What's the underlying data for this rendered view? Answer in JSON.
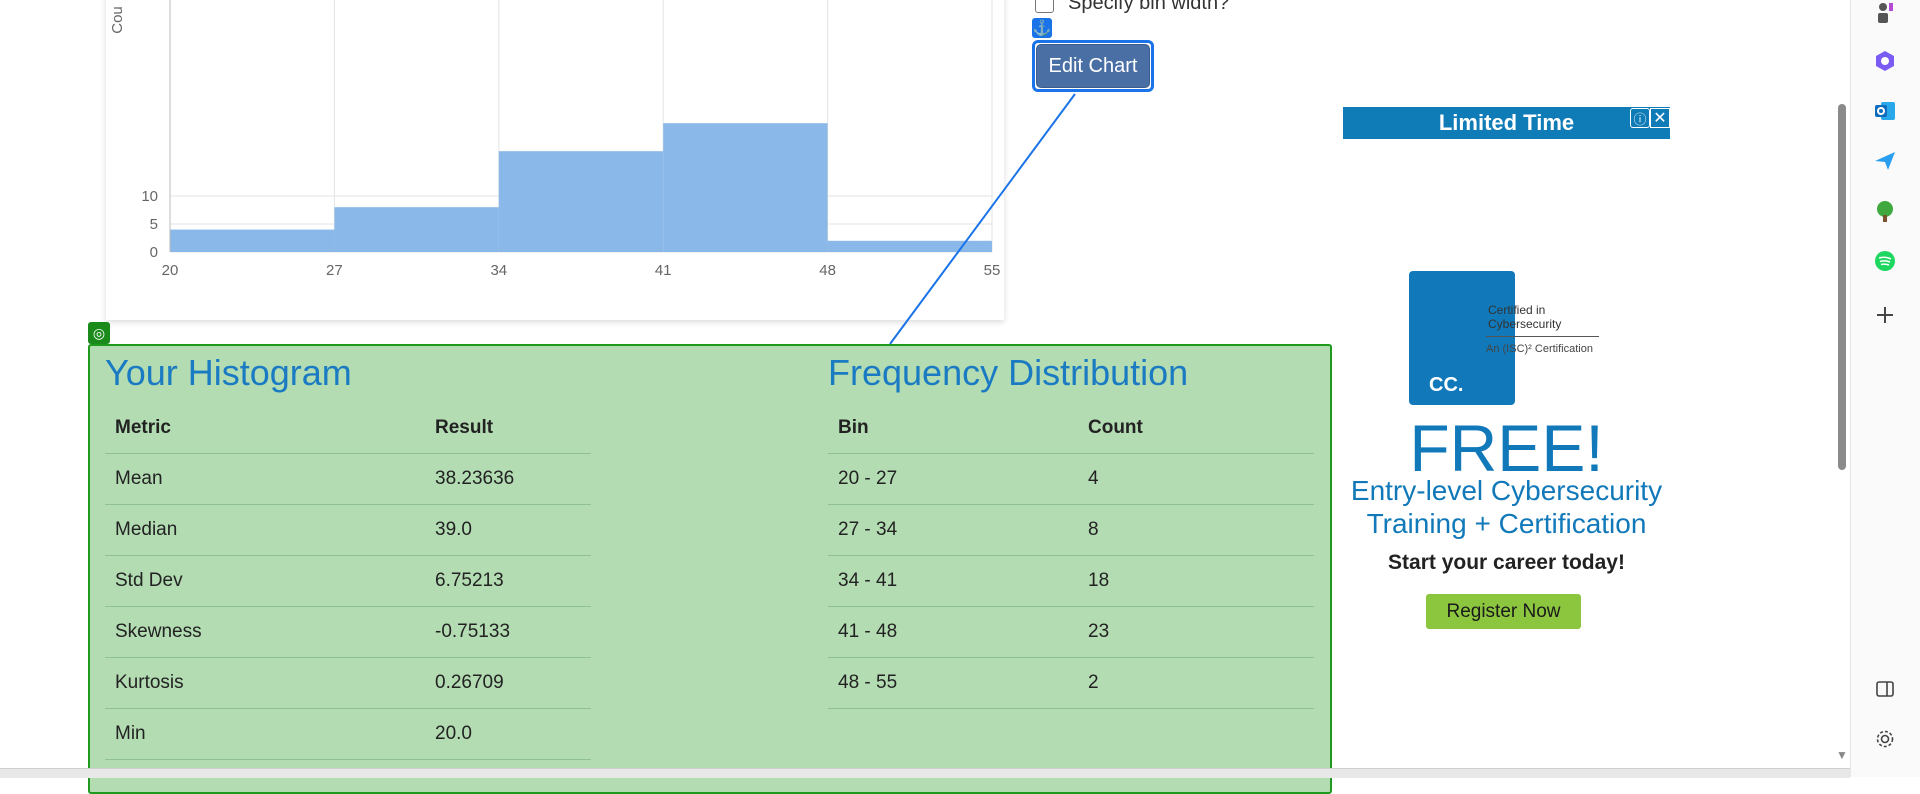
{
  "chart": {
    "ylabel": "Cou",
    "y_ticks": [
      "0",
      "5",
      "10"
    ],
    "x_ticks": [
      "20",
      "27",
      "34",
      "41",
      "48",
      "55"
    ],
    "bar_color": "#8ab8e8"
  },
  "chart_data": {
    "type": "bar",
    "categories": [
      "20 - 27",
      "27 - 34",
      "34 - 41",
      "41 - 48",
      "48 - 55"
    ],
    "values": [
      4,
      8,
      18,
      23,
      2
    ],
    "bin_edges": [
      20,
      27,
      34,
      41,
      48,
      55
    ],
    "ylabel": "Cou",
    "ylim": [
      0,
      10
    ],
    "grid": true
  },
  "controls": {
    "bin_width_label": "Specify bin width?",
    "edit_chart_label": "Edit Chart",
    "anchor_icon": "⚓"
  },
  "results": {
    "histogram_title": "Your Histogram",
    "frequency_title": "Frequency Distribution",
    "metric_header": "Metric",
    "result_header": "Result",
    "metrics": [
      {
        "name": "Mean",
        "value": "38.23636"
      },
      {
        "name": "Median",
        "value": "39.0"
      },
      {
        "name": "Std Dev",
        "value": "6.75213"
      },
      {
        "name": "Skewness",
        "value": "-0.75133"
      },
      {
        "name": "Kurtosis",
        "value": "0.26709"
      },
      {
        "name": "Min",
        "value": "20.0"
      }
    ],
    "bin_header": "Bin",
    "count_header": "Count",
    "bins": [
      {
        "bin": "20 - 27",
        "count": "4"
      },
      {
        "bin": "27 - 34",
        "count": "8"
      },
      {
        "bin": "34 - 41",
        "count": "18"
      },
      {
        "bin": "41 - 48",
        "count": "23"
      },
      {
        "bin": "48 - 55",
        "count": "2"
      }
    ]
  },
  "ad": {
    "banner": "Limited Time",
    "info_icon": "ⓘ",
    "close_icon": "✕",
    "badge_text": "CC.",
    "cert_line1": "Certified in",
    "cert_line2": "Cybersecurity",
    "cert_sub": "An (ISC)² Certification",
    "free": "FREE!",
    "line1": "Entry-level Cybersecurity",
    "line2": "Training + Certification",
    "tagline": "Start your career today!",
    "cta": "Register Now"
  },
  "browser": {
    "scroll_down_icon": "▼"
  }
}
